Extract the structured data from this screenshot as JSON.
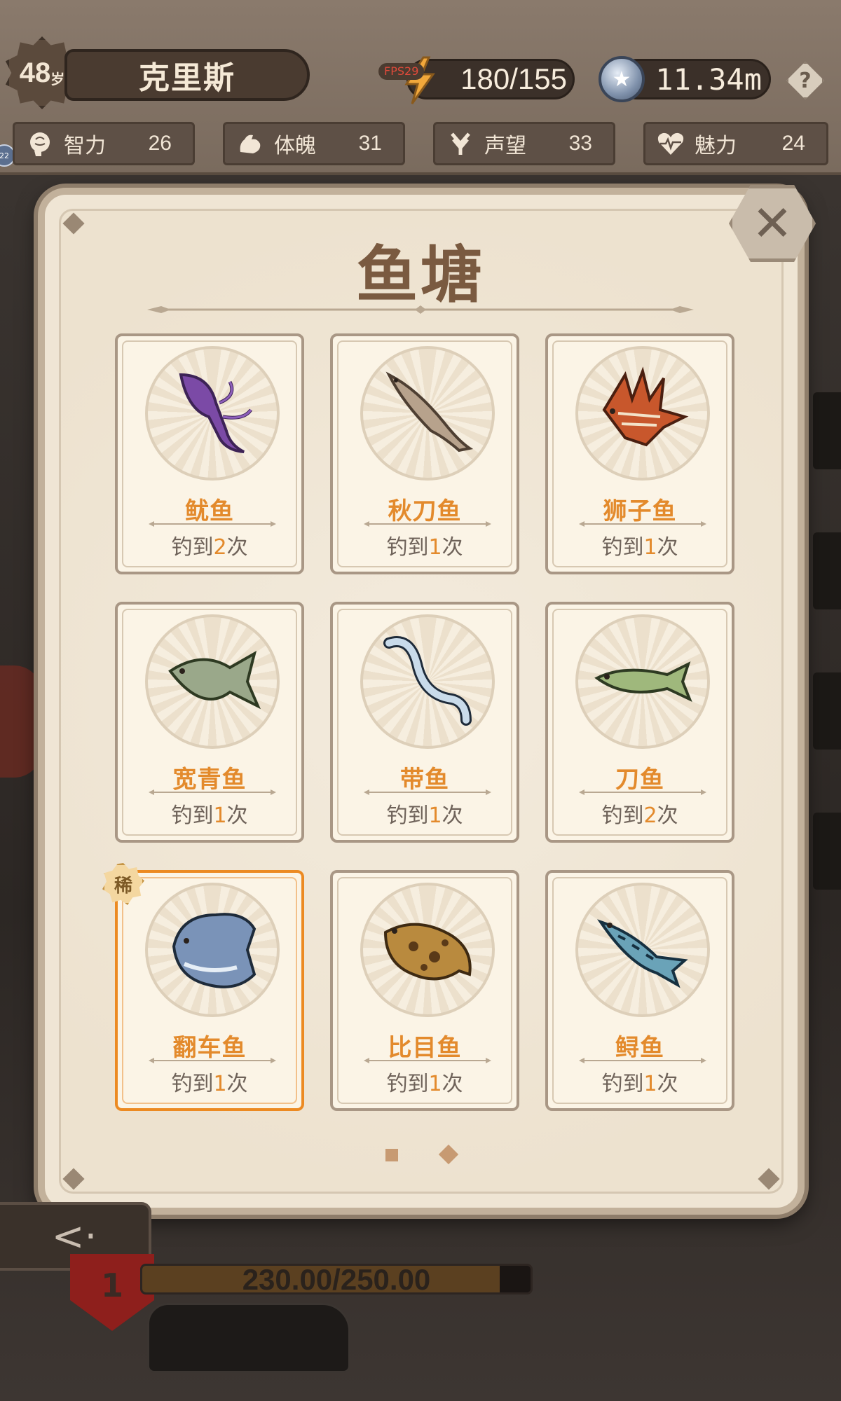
{
  "header": {
    "age": "48",
    "age_unit": "岁",
    "name": "克里斯",
    "fps_label": "FPS29",
    "energy": "180/155",
    "coins": "11.34m",
    "help": "?",
    "avatar_text": "22"
  },
  "stats": [
    {
      "label": "智力",
      "value": "26",
      "icon": "brain-icon"
    },
    {
      "label": "体魄",
      "value": "31",
      "icon": "muscle-icon"
    },
    {
      "label": "声望",
      "value": "33",
      "icon": "laurel-icon"
    },
    {
      "label": "魅力",
      "value": "24",
      "icon": "heart-pulse-icon"
    }
  ],
  "modal": {
    "title": "鱼塘",
    "close": "✕",
    "fish": [
      {
        "name": "鱿鱼",
        "prefix": "钓到",
        "count": "2",
        "suffix": "次",
        "color": "#7b4aa6",
        "rare": false
      },
      {
        "name": "秋刀鱼",
        "prefix": "钓到",
        "count": "1",
        "suffix": "次",
        "color": "#b7a28c",
        "rare": false
      },
      {
        "name": "狮子鱼",
        "prefix": "钓到",
        "count": "1",
        "suffix": "次",
        "color": "#c8572c",
        "rare": false
      },
      {
        "name": "宽青鱼",
        "prefix": "钓到",
        "count": "1",
        "suffix": "次",
        "color": "#9aa88a",
        "rare": false
      },
      {
        "name": "带鱼",
        "prefix": "钓到",
        "count": "1",
        "suffix": "次",
        "color": "#a9c2d8",
        "rare": false
      },
      {
        "name": "刀鱼",
        "prefix": "钓到",
        "count": "2",
        "suffix": "次",
        "color": "#9fb87c",
        "rare": false
      },
      {
        "name": "翻车鱼",
        "prefix": "钓到",
        "count": "1",
        "suffix": "次",
        "color": "#7a93b8",
        "rare": true,
        "badge": "稀"
      },
      {
        "name": "比目鱼",
        "prefix": "钓到",
        "count": "1",
        "suffix": "次",
        "color": "#b98a3e",
        "rare": false
      },
      {
        "name": "鲟鱼",
        "prefix": "钓到",
        "count": "1",
        "suffix": "次",
        "color": "#6aa3b8",
        "rare": false
      }
    ]
  },
  "bottom": {
    "back": "<·",
    "level": "1",
    "hp_text": "230.00/250.00",
    "hp_fraction": 0.92
  },
  "colors": {
    "accent": "#e38a2c",
    "rare_border": "#ec8a22",
    "title": "#7a5a40"
  }
}
